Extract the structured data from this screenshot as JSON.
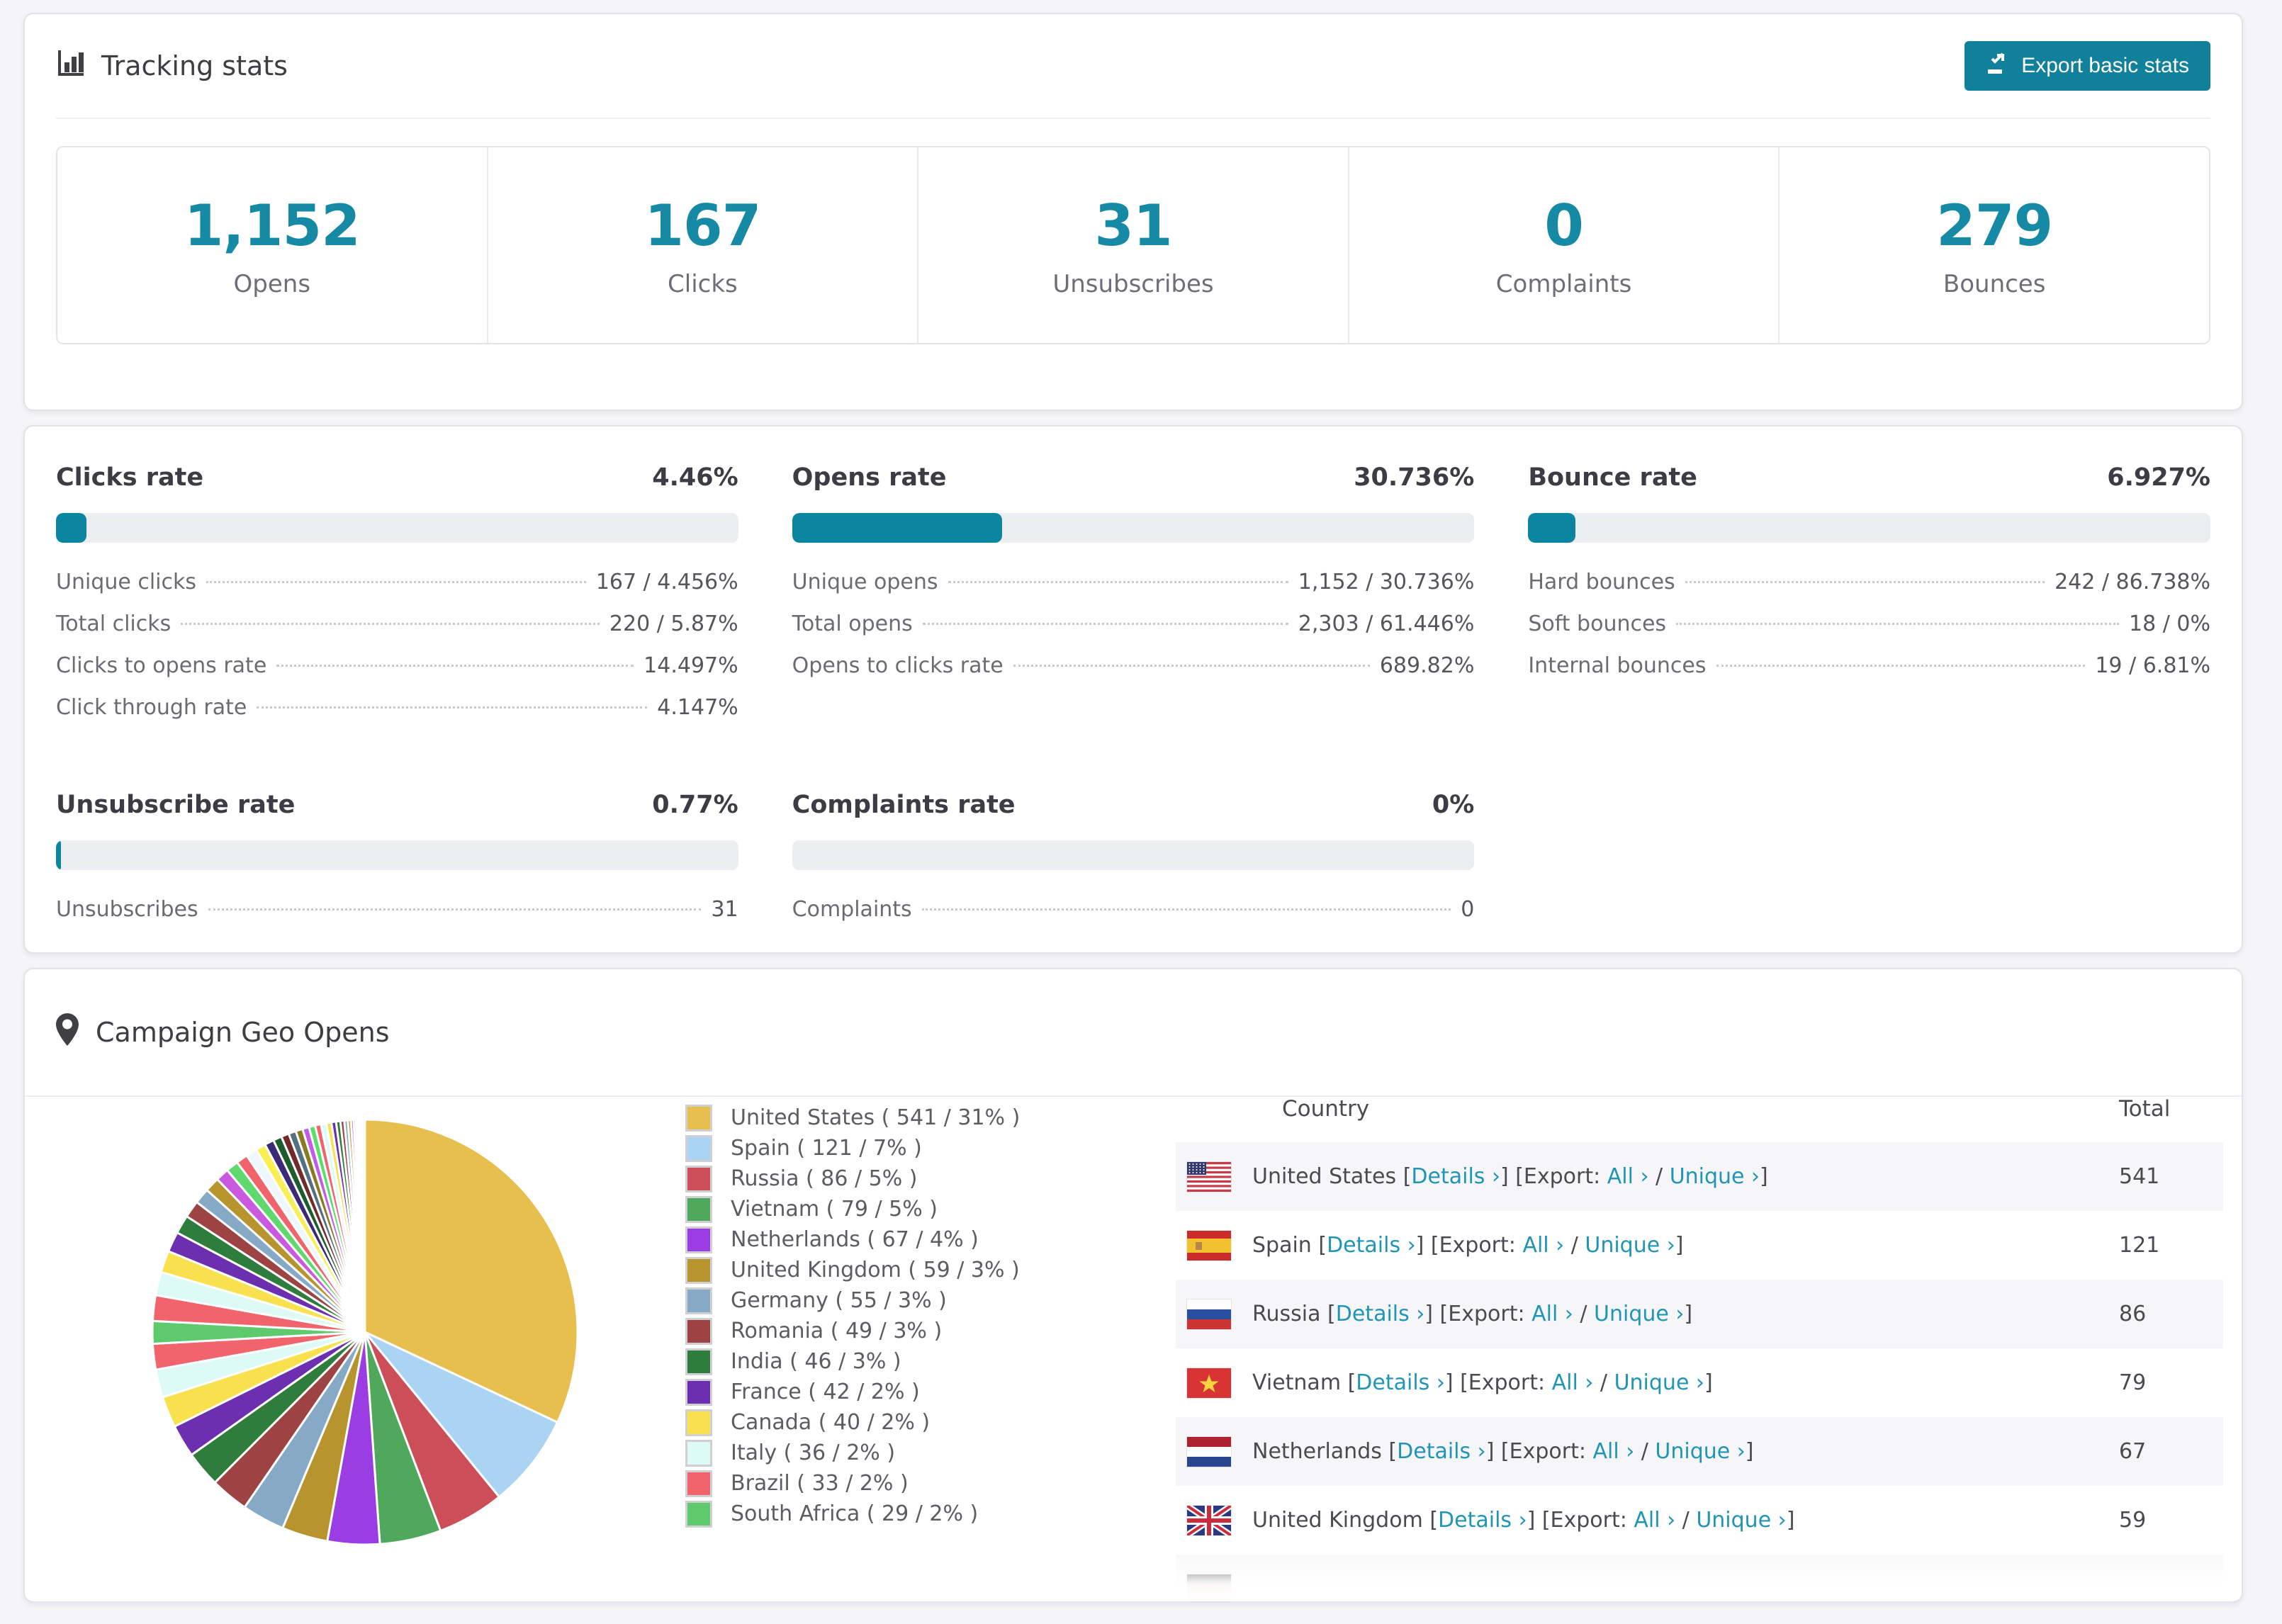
{
  "accent": "#1287a1",
  "link_color": "#2095b5",
  "header": {
    "title": "Tracking stats",
    "export_button": "Export basic stats"
  },
  "summary": [
    {
      "value": "1,152",
      "label": "Opens"
    },
    {
      "value": "167",
      "label": "Clicks"
    },
    {
      "value": "31",
      "label": "Unsubscribes"
    },
    {
      "value": "0",
      "label": "Complaints"
    },
    {
      "value": "279",
      "label": "Bounces"
    }
  ],
  "rates": {
    "clicks": {
      "title": "Clicks rate",
      "percent": "4.46%",
      "bar_percent": 4.46,
      "rows": [
        {
          "label": "Unique clicks",
          "value": "167 / 4.456%"
        },
        {
          "label": "Total clicks",
          "value": "220 / 5.87%"
        },
        {
          "label": "Clicks to opens rate",
          "value": "14.497%"
        },
        {
          "label": "Click through rate",
          "value": "4.147%"
        }
      ]
    },
    "opens": {
      "title": "Opens rate",
      "percent": "30.736%",
      "bar_percent": 30.736,
      "rows": [
        {
          "label": "Unique opens",
          "value": "1,152 / 30.736%"
        },
        {
          "label": "Total opens",
          "value": "2,303 / 61.446%"
        },
        {
          "label": "Opens to clicks rate",
          "value": "689.82%"
        }
      ]
    },
    "bounce": {
      "title": "Bounce rate",
      "percent": "6.927%",
      "bar_percent": 6.927,
      "rows": [
        {
          "label": "Hard bounces",
          "value": "242 / 86.738%"
        },
        {
          "label": "Soft bounces",
          "value": "18 / 0%"
        },
        {
          "label": "Internal bounces",
          "value": "19 / 6.81%"
        }
      ]
    },
    "unsubscribe": {
      "title": "Unsubscribe rate",
      "percent": "0.77%",
      "bar_percent": 0.77,
      "rows": [
        {
          "label": "Unsubscribes",
          "value": "31"
        }
      ]
    },
    "complaints": {
      "title": "Complaints rate",
      "percent": "0%",
      "bar_percent": 0,
      "rows": [
        {
          "label": "Complaints",
          "value": "0"
        }
      ]
    }
  },
  "geo": {
    "title": "Campaign Geo Opens",
    "table": {
      "columns": {
        "country": "Country",
        "total": "Total"
      },
      "details_label": "Details ›",
      "export_prefix": "Export:",
      "all_label": "All ›",
      "unique_label": "Unique ›",
      "rows": [
        {
          "flag": "us",
          "name": "United States",
          "total": "541"
        },
        {
          "flag": "es",
          "name": "Spain",
          "total": "121"
        },
        {
          "flag": "ru",
          "name": "Russia",
          "total": "86"
        },
        {
          "flag": "vn",
          "name": "Vietnam",
          "total": "79"
        },
        {
          "flag": "nl",
          "name": "Netherlands",
          "total": "67"
        },
        {
          "flag": "gb",
          "name": "United Kingdom",
          "total": "59"
        },
        {
          "flag": "de",
          "name": "",
          "total": ""
        }
      ]
    }
  },
  "chart_data": {
    "type": "pie",
    "title": "Campaign Geo Opens",
    "legend_position": "right",
    "start_angle_deg": -90,
    "direction": "clockwise",
    "series": [
      {
        "name": "United States",
        "value": 541,
        "pct": "31%",
        "color": "#e7bf4e"
      },
      {
        "name": "Spain",
        "value": 121,
        "pct": "7%",
        "color": "#abd3f2"
      },
      {
        "name": "Russia",
        "value": 86,
        "pct": "5%",
        "color": "#cb4e59"
      },
      {
        "name": "Vietnam",
        "value": 79,
        "pct": "5%",
        "color": "#4fa85c"
      },
      {
        "name": "Netherlands",
        "value": 67,
        "pct": "4%",
        "color": "#9a3de3"
      },
      {
        "name": "United Kingdom",
        "value": 59,
        "pct": "3%",
        "color": "#b7942e"
      },
      {
        "name": "Germany",
        "value": 55,
        "pct": "3%",
        "color": "#86a9c5"
      },
      {
        "name": "Romania",
        "value": 49,
        "pct": "3%",
        "color": "#9d4343"
      },
      {
        "name": "India",
        "value": 46,
        "pct": "3%",
        "color": "#2e7d3d"
      },
      {
        "name": "France",
        "value": 42,
        "pct": "2%",
        "color": "#6c2fb0"
      },
      {
        "name": "Canada",
        "value": 40,
        "pct": "2%",
        "color": "#f8e04e"
      },
      {
        "name": "Italy",
        "value": 36,
        "pct": "2%",
        "color": "#defaf6"
      },
      {
        "name": "Brazil",
        "value": 33,
        "pct": "2%",
        "color": "#f2646c"
      },
      {
        "name": "South Africa",
        "value": 29,
        "pct": "2%",
        "color": "#5fc96d"
      }
    ],
    "unlabeled_slices": {
      "note": "remaining small countries shown as thin unlabeled wedges",
      "values": [
        33,
        30,
        28,
        26,
        24,
        22,
        20,
        19,
        17,
        16,
        15,
        14,
        13,
        12,
        11,
        10,
        9.5,
        9,
        8.5,
        8,
        7.5,
        7,
        6.5,
        6,
        5.5,
        5,
        4.5,
        4,
        3.5,
        3,
        2.5,
        2,
        1.7,
        1.4,
        1.1,
        0.9,
        0.7,
        0.5,
        0.35,
        0.2
      ],
      "colors": [
        "#f2646c",
        "#defaf6",
        "#f8e04e",
        "#6c2fb0",
        "#2e7d3d",
        "#9d4343",
        "#86a9c5",
        "#b7942e",
        "#c95ae0",
        "#5fd96d",
        "#f2646c",
        "#eef8fc",
        "#f8ef55",
        "#3b2a78",
        "#1d5c2e",
        "#722b2b",
        "#55707f",
        "#8a7a22",
        "#c45ae8",
        "#55e06a"
      ]
    }
  }
}
